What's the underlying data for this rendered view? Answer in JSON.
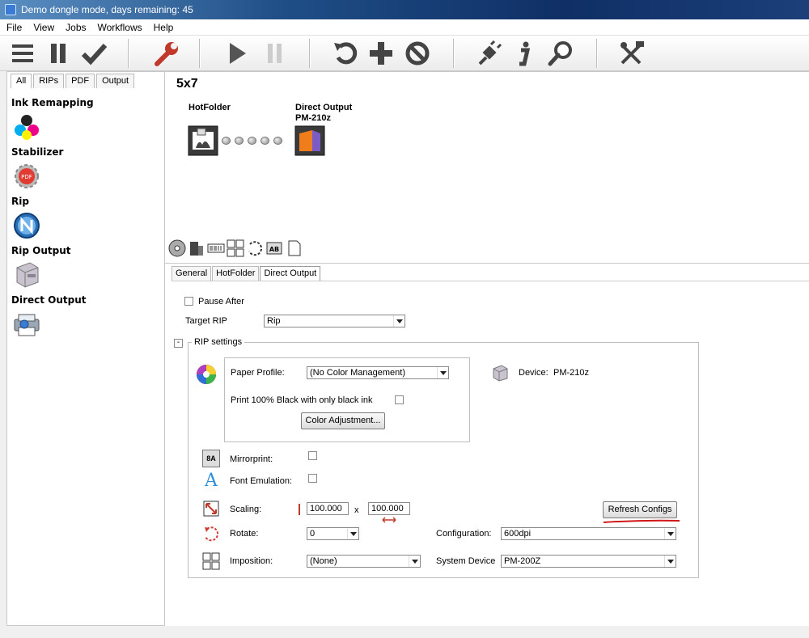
{
  "window": {
    "title": "Demo dongle mode, days remaining: 45"
  },
  "menu": [
    "File",
    "View",
    "Jobs",
    "Workflows",
    "Help"
  ],
  "toolbar": {
    "icons": [
      "menu-icon",
      "pause-icon",
      "checkmark-icon",
      "wrench-icon",
      "play-icon",
      "pause-disabled-icon",
      "undo-icon",
      "plus-icon",
      "cancel-icon",
      "plug-icon",
      "info-icon",
      "magnifier-icon",
      "tools-icon"
    ]
  },
  "sidebar": {
    "tabs": [
      "All",
      "RIPs",
      "PDF",
      "Output"
    ],
    "items": [
      {
        "label": "Ink Remapping",
        "icon": "ink-drops-icon"
      },
      {
        "label": "Stabilizer",
        "icon": "pdf-gear-icon"
      },
      {
        "label": "Rip",
        "icon": "rip-icon"
      },
      {
        "label": "Rip Output",
        "icon": "printer-box-icon"
      },
      {
        "label": "Direct Output",
        "icon": "printer-icon"
      }
    ]
  },
  "workflow": {
    "name": "5x7",
    "nodes": [
      {
        "label": "HotFolder",
        "sublabel": ""
      },
      {
        "label": "Direct Output",
        "sublabel": "PM-210z"
      }
    ]
  },
  "panel": {
    "tabs": [
      "General",
      "HotFolder",
      "Direct Output"
    ],
    "active_tab": "Direct Output",
    "pause_after": {
      "label": "Pause After",
      "checked": false
    },
    "target_rip": {
      "label": "Target RIP",
      "value": "Rip"
    },
    "rip_settings": {
      "collapse_glyph": "-",
      "title": "RIP settings",
      "paper_profile": {
        "label": "Paper Profile:",
        "value": "(No Color Management)"
      },
      "black_only": {
        "label": "Print 100% Black with only black ink",
        "checked": false
      },
      "color_adjustment_label": "Color Adjustment...",
      "device_label": "Device:",
      "device_value": "PM-210z",
      "mirrorprint": {
        "label": "Mirrorprint:",
        "checked": false,
        "icon_text": "8A"
      },
      "font_emulation": {
        "label": "Font Emulation:",
        "checked": false,
        "icon_text": "A"
      },
      "scaling": {
        "label": "Scaling:",
        "x": "100.000",
        "sep": "x",
        "y": "100.000"
      },
      "refresh_label": "Refresh Configs",
      "rotate": {
        "label": "Rotate:",
        "value": "0"
      },
      "configuration": {
        "label": "Configuration:",
        "value": "600dpi"
      },
      "imposition": {
        "label": "Imposition:",
        "value": "(None)"
      },
      "system_device": {
        "label": "System Device",
        "value": "PM-200Z"
      }
    }
  },
  "colors": {
    "annotation_underline": "#d01818",
    "titlebar": "#1f4e86"
  }
}
